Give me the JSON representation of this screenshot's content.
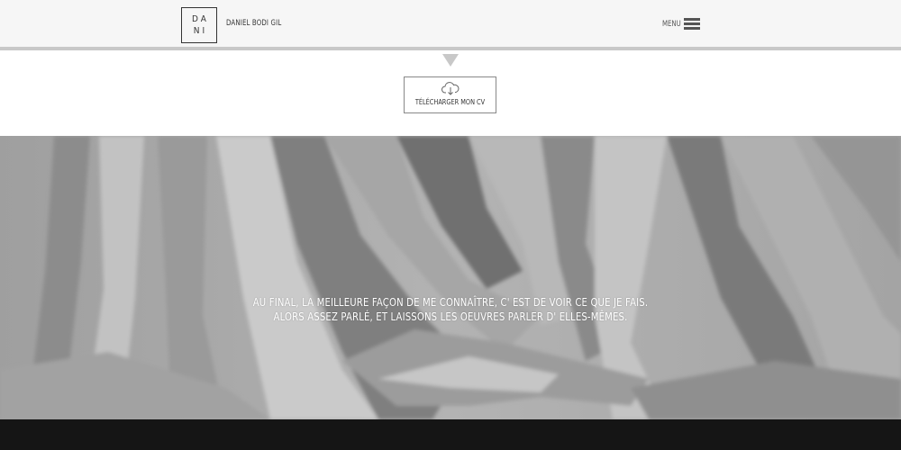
{
  "header": {
    "logo_line1": "DA",
    "logo_line2": "NI",
    "site_name": "DANIEL BODI GIL",
    "menu_label": "MENU"
  },
  "cv_button": {
    "label": "TÉLÉCHARGER MON CV",
    "icon": "cloud-download-icon"
  },
  "hero": {
    "line1": "AU FINAL, LA MEILLEURE FAÇON DE ME CONNAÎTRE, C' EST DE VOIR CE QUE JE FAIS.",
    "line2": "ALORS ASSEZ PARLÉ, ET LAISSONS LES OEUVRES PARLER D' ELLES-MÊMES."
  },
  "colors": {
    "header_bg": "#f6f6f6",
    "header_border": "#c8c8c8",
    "hero_bg": "#a9a9a9",
    "footer_bg": "#151515",
    "text_dark": "#333333",
    "text_light": "#ffffff"
  }
}
